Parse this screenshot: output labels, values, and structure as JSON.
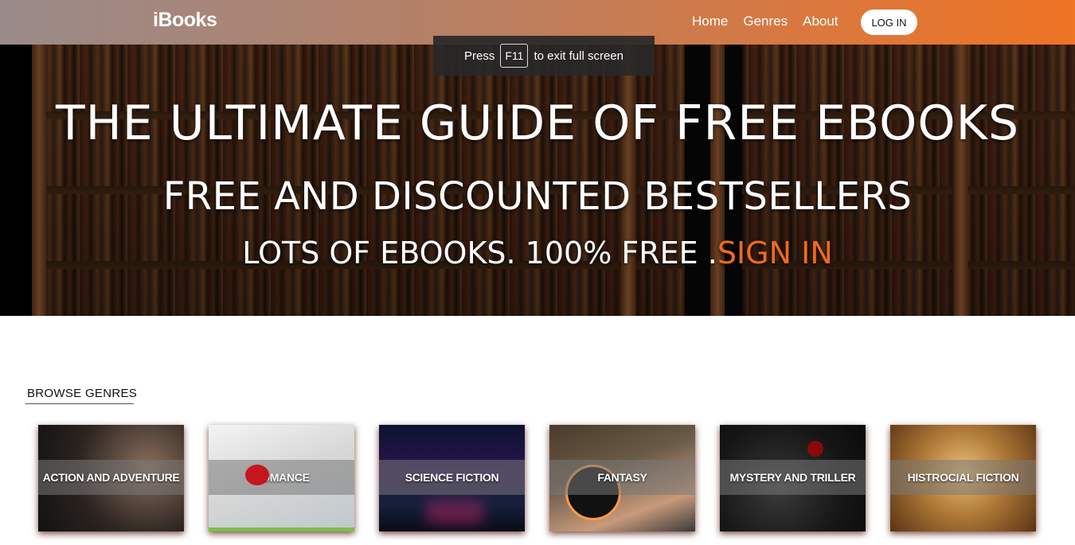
{
  "navbar": {
    "logo": "iBooks",
    "links": [
      "Home",
      "Genres",
      "About"
    ],
    "login_label": "LOG IN"
  },
  "fullscreen_toast": {
    "prefix": "Press",
    "key": "F11",
    "suffix": "to exit full screen"
  },
  "hero": {
    "line1": "THE ULTIMATE GUIDE OF FREE EBOOKS",
    "line2": "FREE AND DISCOUNTED BESTSELLERS",
    "line3_text": "LOTS OF EBOOKS. 100% FREE .",
    "line3_link": "SIGN IN"
  },
  "genres": {
    "title": "BROWSE GENRES",
    "items": [
      "ACTION AND ADVENTURE",
      "ROMANCE",
      "SCIENCE FICTION",
      "FANTASY",
      "MYSTERY AND TRILLER",
      "HISTROCIAL FICTION"
    ]
  },
  "colors": {
    "accent": "#ef6a1f",
    "nav_gradient_start": "#9a8b8a",
    "nav_gradient_end": "#ef7424"
  }
}
